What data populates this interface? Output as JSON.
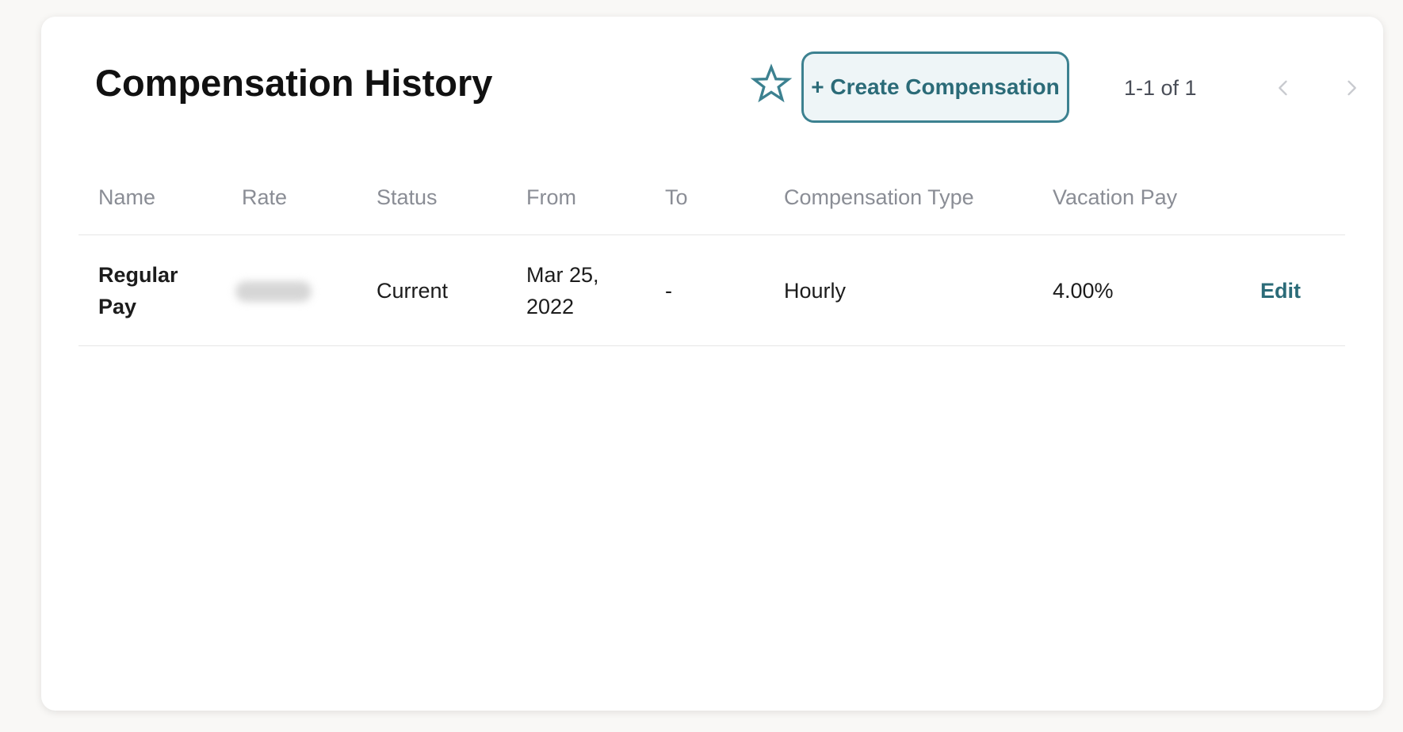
{
  "header": {
    "title": "Compensation History",
    "create_button_label": "+ Create Compensation",
    "pagination": "1-1 of 1"
  },
  "table": {
    "columns": [
      "Name",
      "Rate",
      "Status",
      "From",
      "To",
      "Compensation Type",
      "Vacation Pay"
    ],
    "rows": [
      {
        "name_line1": "Regular",
        "name_line2": "Pay",
        "rate": "",
        "status": "Current",
        "from_line1": "Mar 25,",
        "from_line2": "2022",
        "to": "-",
        "compensation_type": "Hourly",
        "vacation_pay": "4.00%",
        "action": "Edit"
      }
    ]
  },
  "icons": {
    "favorite": "star-icon",
    "prev": "chevron-left-icon",
    "next": "chevron-right-icon"
  },
  "colors": {
    "accent": "#3c8190",
    "accent_text": "#2b6b78",
    "button_bg": "#eef5f7"
  }
}
